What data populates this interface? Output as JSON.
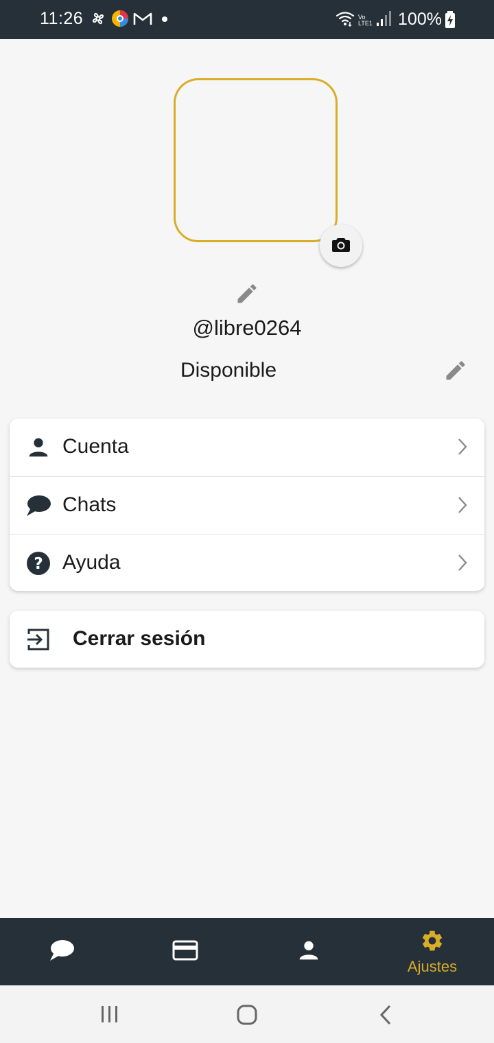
{
  "status_bar": {
    "time": "11:26",
    "battery": "100%",
    "icons_left": [
      "fan-icon",
      "browser-icon",
      "gmail-icon",
      "dot-icon"
    ],
    "icons_right": [
      "wifi-icon",
      "volte-icon",
      "signal-icon",
      "battery-charging-icon"
    ],
    "volte_label": "Vo LTE1"
  },
  "profile": {
    "username": "@libre0264",
    "status": "Disponible",
    "avatar_border_color": "#d9ad27"
  },
  "settings": {
    "items": [
      {
        "label": "Cuenta",
        "icon": "person-icon"
      },
      {
        "label": "Chats",
        "icon": "chat-bubble-icon"
      },
      {
        "label": "Ayuda",
        "icon": "help-icon"
      }
    ]
  },
  "logout": {
    "label": "Cerrar sesión",
    "icon": "exit-icon"
  },
  "bottom_nav": {
    "items": [
      {
        "icon": "chat-bubble-icon",
        "label": ""
      },
      {
        "icon": "card-icon",
        "label": ""
      },
      {
        "icon": "person-icon",
        "label": ""
      },
      {
        "icon": "gear-icon",
        "label": "Ajustes",
        "active": true
      }
    ],
    "active_color": "#d9ad27",
    "inactive_color": "#ffffff"
  },
  "system_nav": {
    "buttons": [
      "recents-button",
      "home-button",
      "back-button"
    ]
  }
}
